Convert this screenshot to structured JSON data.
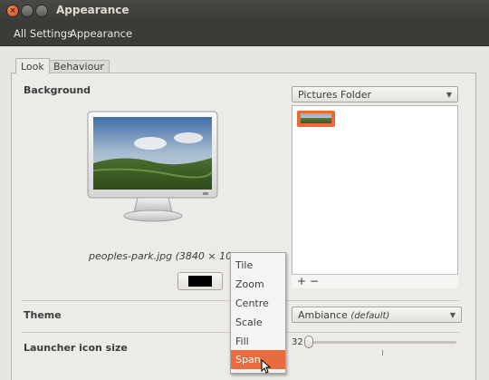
{
  "window": {
    "title": "Appearance"
  },
  "toolbar": {
    "all_settings": "All Settings",
    "appearance": "Appearance"
  },
  "tabs": [
    {
      "label": "Look"
    },
    {
      "label": "Behaviour"
    }
  ],
  "background": {
    "heading": "Background",
    "source": "Pictures Folder",
    "caption": "peoples-park.jpg (3840 × 1080)",
    "color": "#000000"
  },
  "panel": {
    "add": "+",
    "remove": "−"
  },
  "theme": {
    "heading": "Theme",
    "value": "Ambiance",
    "note": "(default)"
  },
  "launcher": {
    "heading": "Launcher icon size",
    "value": "32"
  },
  "menu": {
    "items": [
      "Tile",
      "Zoom",
      "Centre",
      "Scale",
      "Fill",
      "Span"
    ],
    "selected": "Span"
  },
  "colors": {
    "accent": "#e96b3e",
    "titlebar": "#3c3b37",
    "window_bg": "#edebe8"
  },
  "icons": [
    "close-icon",
    "minimize-icon",
    "maximize-icon",
    "chevron-down-icon",
    "monitor-icon",
    "mouse-pointer-icon"
  ]
}
